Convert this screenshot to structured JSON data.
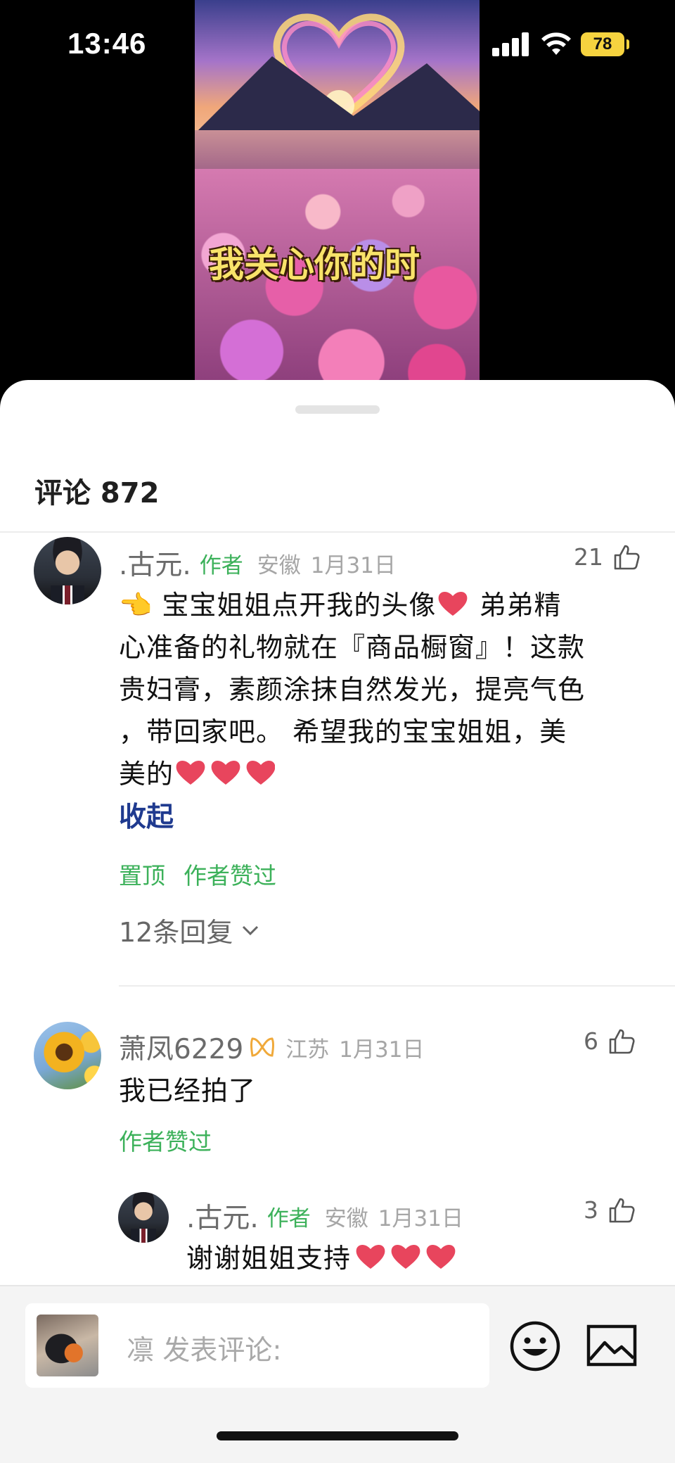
{
  "status_bar": {
    "time": "13:46",
    "battery": "78",
    "battery_color": "#f6d33f"
  },
  "video": {
    "caption": "我关心你的时"
  },
  "sheet": {
    "title": "评论 872"
  },
  "comments": [
    {
      "name": ".古元.",
      "author_tag": "作者",
      "location": "安徽",
      "date": "1月31日",
      "likes": "21",
      "text_lines": [
        "👈 宝宝姐姐点开我的头像",
        "心准备的礼物就在『商品橱窗』！这款",
        "贵妇膏，素颜涂抹自然发光，提亮气色",
        "，带回家吧。  希望我的宝宝姐姐，美",
        "美的"
      ],
      "text_line1_tail": "  弟弟精",
      "collapse": "收起",
      "tags": [
        "置顶",
        "作者赞过"
      ],
      "replies": "12条回复"
    },
    {
      "name": "萧凤6229",
      "badge_icon": "ribbon-badge-icon",
      "location": "江苏",
      "date": "1月31日",
      "likes": "6",
      "text": "我已经拍了",
      "tags": [
        "作者赞过"
      ]
    },
    {
      "name": ".古元.",
      "author_tag": "作者",
      "location": "安徽",
      "date": "1月31日",
      "likes": "3",
      "text": "谢谢姐姐支持"
    }
  ],
  "composer": {
    "placeholder": "凛 发表评论:",
    "emoji_icon": "smile-icon",
    "image_icon": "image-icon"
  },
  "colors": {
    "accent_green": "#3cb15a",
    "link_blue": "#1f3a8f",
    "heart": "#e8455d"
  }
}
